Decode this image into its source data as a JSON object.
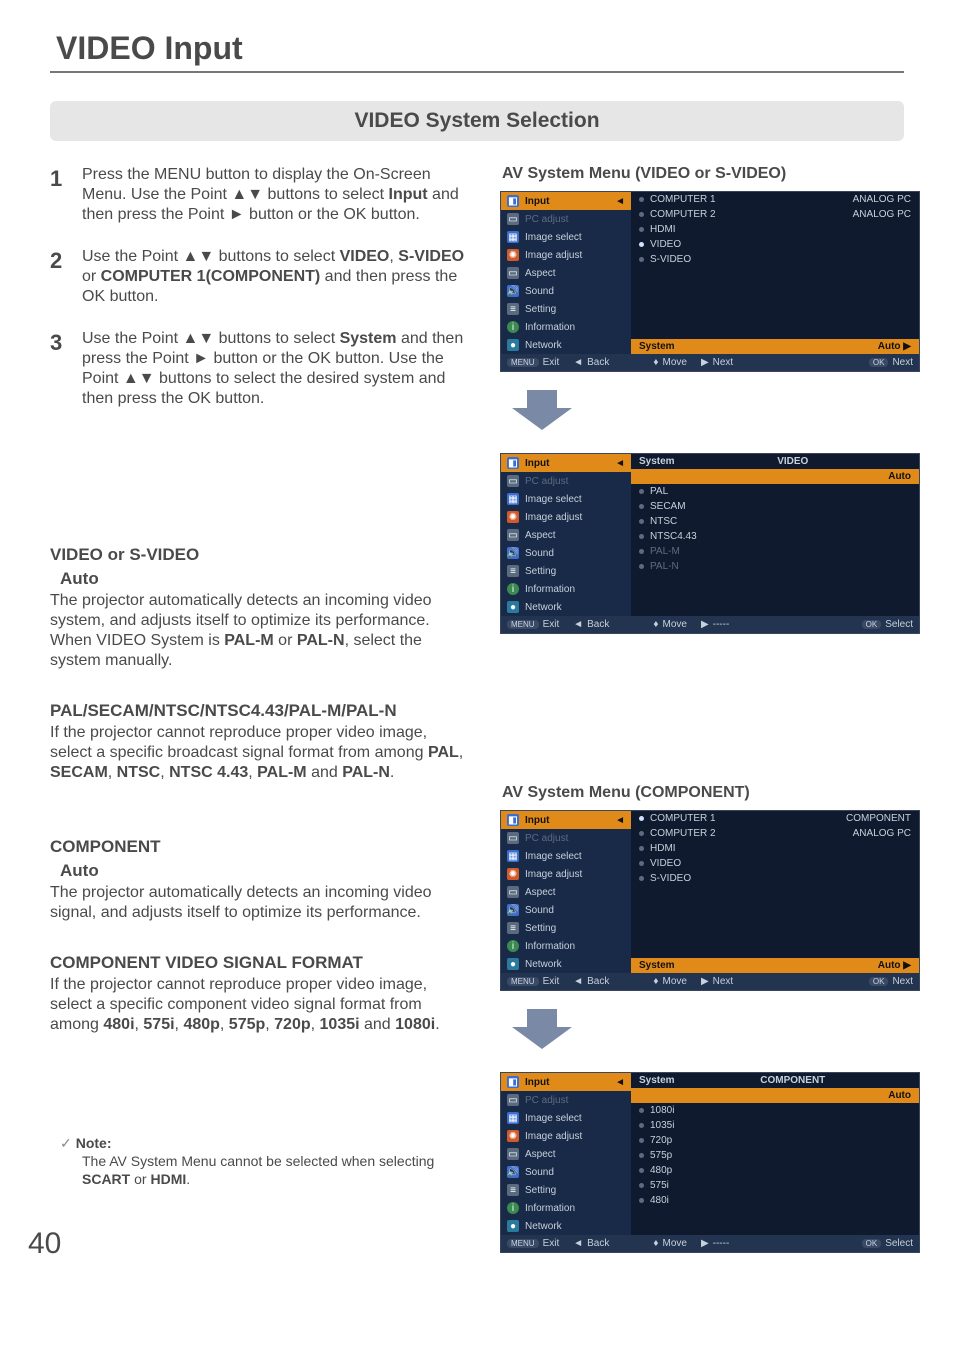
{
  "page": {
    "number": "40",
    "title": "VIDEO Input",
    "section_bar": "VIDEO System Selection"
  },
  "steps": {
    "s1": {
      "num": "1",
      "pre": "Press the MENU button to display the On-Screen Menu. Use the Point ▲▼ buttons to select ",
      "bold": "Input",
      "post": " and then press the Point ► button or the OK button."
    },
    "s2": {
      "num": "2",
      "pre": "Use the Point ▲▼ buttons to select ",
      "b1": "VIDEO",
      "mid1": ", ",
      "b2": "S-VIDEO",
      "mid2": " or ",
      "b3": "COMPUTER 1(COMPONENT)",
      "post": " and then press the OK button."
    },
    "s3": {
      "num": "3",
      "pre": "Use the Point ▲▼ buttons to select ",
      "b1": "System",
      "post": " and then press the Point ► button or the OK button. Use the Point ▲▼ buttons to select the desired system and then press the OK button."
    }
  },
  "left": {
    "video_head": "VIDEO or S-VIDEO",
    "auto_head": "Auto",
    "auto_para_pre": "The projector automatically detects an incoming video system, and adjusts itself to optimize its performance. When VIDEO System is ",
    "auto_b1": "PAL-M",
    "auto_mid": " or ",
    "auto_b2": "PAL-N",
    "auto_post": ", select the system manually.",
    "pal_head": "PAL/SECAM/NTSC/NTSC4.43/PAL-M/PAL-N",
    "pal_para_pre": "If the projector cannot reproduce proper video image, select a specific broadcast signal format from among ",
    "p_b1": "PAL",
    "p_c1": ", ",
    "p_b2": "SECAM",
    "p_c2": ", ",
    "p_b3": "NTSC",
    "p_c3": ", ",
    "p_b4": "NTSC 4.43",
    "p_c4": ", ",
    "p_b5": "PAL-M",
    "p_c5": " and ",
    "p_b6": "PAL-N",
    "p_c6": ".",
    "comp_head": "COMPONENT",
    "comp_auto_head": "Auto",
    "comp_auto_para": "The projector automatically detects an incoming video signal, and adjusts itself to optimize its performance.",
    "cvf_head": "COMPONENT VIDEO SIGNAL FORMAT",
    "cvf_pre": "If the projector cannot reproduce proper video image, select a specific component video signal format from among ",
    "c_b1": "480i",
    "c_c1": ", ",
    "c_b2": "575i",
    "c_c2": ", ",
    "c_b3": "480p",
    "c_c3": ", ",
    "c_b4": "575p",
    "c_c4": ", ",
    "c_b5": "720p",
    "c_c5": ", ",
    "c_b6": "1035i",
    "c_c6": " and ",
    "c_b7": "1080i",
    "c_c7": "."
  },
  "note": {
    "label": "Note:",
    "body_pre": "The AV System Menu cannot be selected when selecting ",
    "b1": "SCART",
    "mid": " or ",
    "b2": "HDMI",
    "post": "."
  },
  "right": {
    "menu1_title": "AV System Menu (VIDEO or S-VIDEO)",
    "menu2_title": "AV System Menu (COMPONENT)"
  },
  "osd": {
    "sidebar": {
      "input": "Input",
      "pc_adjust": "PC adjust",
      "image_select": "Image select",
      "image_adjust": "Image adjust",
      "aspect": "Aspect",
      "sound": "Sound",
      "setting": "Setting",
      "information": "Information",
      "network": "Network"
    },
    "footer": {
      "exit": "Exit",
      "back": "Back",
      "move": "Move",
      "next": "Next",
      "ok_next": "Next",
      "select": "Select",
      "dashes": "-----",
      "menu_key": "MENU",
      "ok_key": "OK"
    },
    "m1": {
      "items": [
        "COMPUTER 1",
        "COMPUTER 2",
        "HDMI",
        "VIDEO",
        "S-VIDEO"
      ],
      "right": [
        "ANALOG PC",
        "ANALOG PC"
      ],
      "selected": "VIDEO",
      "sys_label": "System",
      "sys_value": "Auto"
    },
    "m2": {
      "head_label": "System",
      "head_value": "VIDEO",
      "items": [
        "Auto",
        "PAL",
        "SECAM",
        "NTSC",
        "NTSC4.43",
        "PAL-M",
        "PAL-N"
      ],
      "selected": "Auto"
    },
    "m3": {
      "items": [
        "COMPUTER 1",
        "COMPUTER 2",
        "HDMI",
        "VIDEO",
        "S-VIDEO"
      ],
      "right": [
        "COMPONENT",
        "ANALOG PC"
      ],
      "selected": "COMPUTER 1",
      "sys_label": "System",
      "sys_value": "Auto"
    },
    "m4": {
      "head_label": "System",
      "head_value": "COMPONENT",
      "items": [
        "Auto",
        "1080i",
        "1035i",
        "720p",
        "575p",
        "480p",
        "575i",
        "480i"
      ],
      "selected": "Auto"
    }
  }
}
